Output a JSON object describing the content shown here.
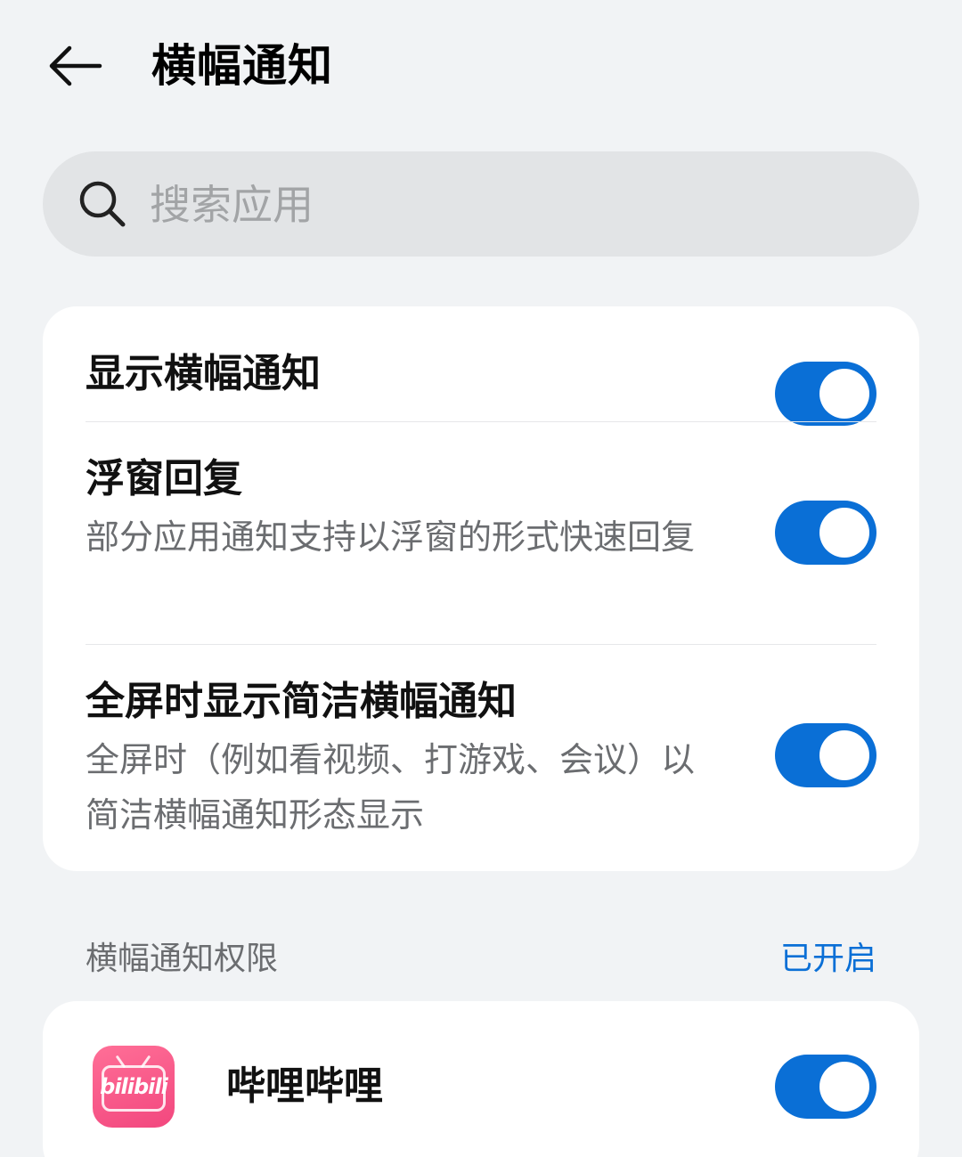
{
  "header": {
    "title": "横幅通知"
  },
  "search": {
    "placeholder": "搜索应用"
  },
  "settings": [
    {
      "title": "显示横幅通知",
      "description": "",
      "enabled": true
    },
    {
      "title": "浮窗回复",
      "description": "部分应用通知支持以浮窗的形式快速回复",
      "enabled": true
    },
    {
      "title": "全屏时显示简洁横幅通知",
      "description": "全屏时（例如看视频、打游戏、会议）以简洁横幅通知形态显示",
      "enabled": true
    }
  ],
  "permission_section": {
    "title": "横幅通知权限",
    "status": "已开启"
  },
  "apps": [
    {
      "name": "哔哩哔哩",
      "icon_logo": "bilibili",
      "enabled": true
    }
  ],
  "colors": {
    "accent": "#0a6fd6",
    "background": "#f1f3f5",
    "card": "#ffffff",
    "app_icon_pink": "#fb5d8b"
  }
}
